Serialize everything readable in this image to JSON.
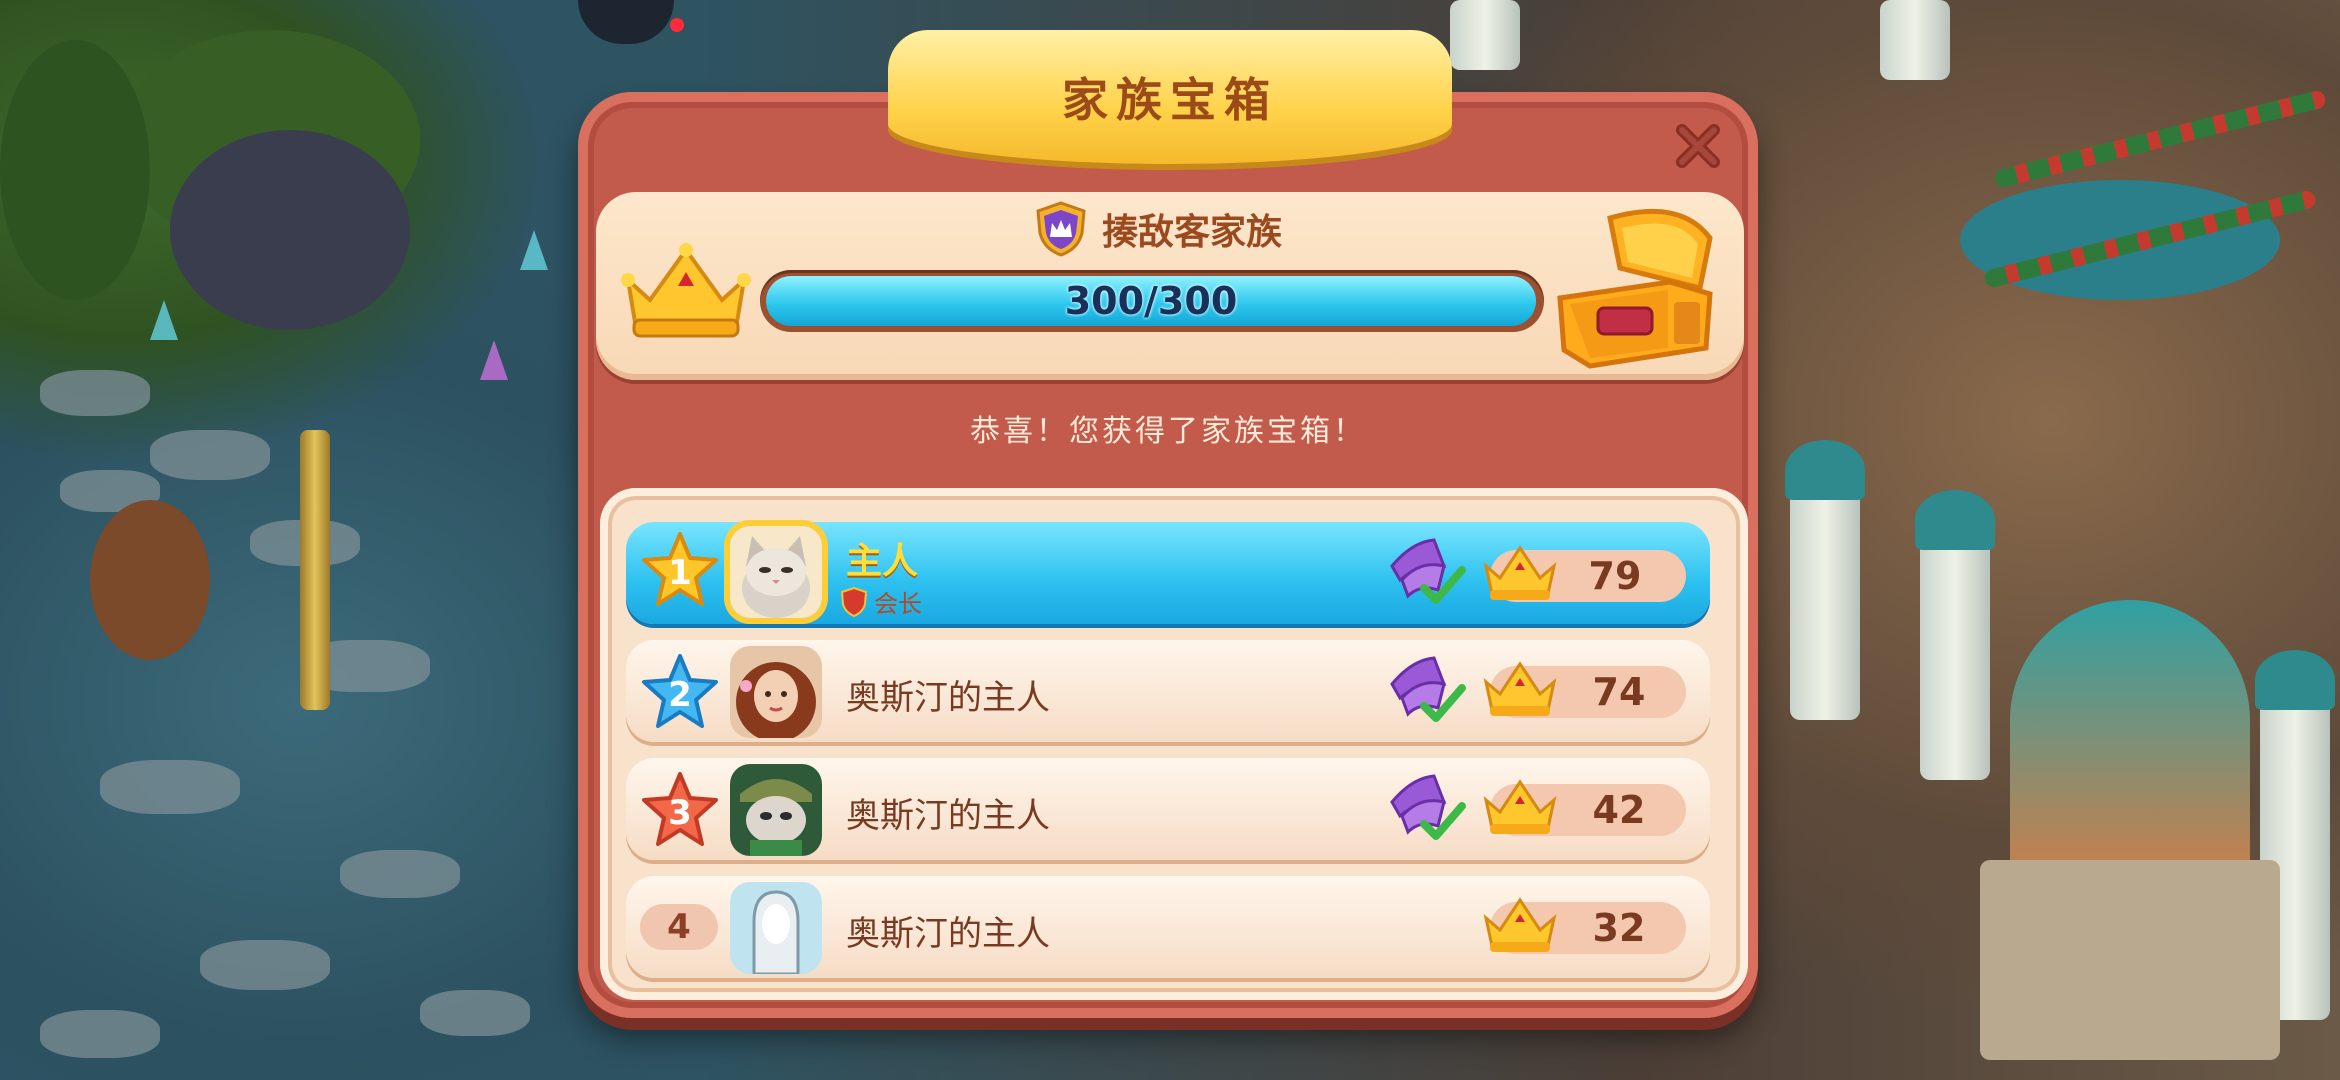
{
  "dialog": {
    "title": "家族宝箱",
    "family_name": "揍敌客家族",
    "progress": {
      "current": 300,
      "max": 300,
      "text": "300/300"
    },
    "congrats": "恭喜！您获得了家族宝箱！"
  },
  "ranking": [
    {
      "rank": "1",
      "name": "主人",
      "role": "会长",
      "score": "79",
      "has_badge": true,
      "highlight": true,
      "star_color": "#ffc62a"
    },
    {
      "rank": "2",
      "name": "奥斯汀的主人",
      "score": "74",
      "has_badge": true,
      "highlight": false,
      "star_color": "#44b8f2"
    },
    {
      "rank": "3",
      "name": "奥斯汀的主人",
      "score": "42",
      "has_badge": true,
      "highlight": false,
      "star_color": "#f26848"
    },
    {
      "rank": "4",
      "name": "奥斯汀的主人",
      "score": "32",
      "has_badge": false,
      "highlight": false
    }
  ],
  "icons": {
    "close": "close-icon",
    "crown": "crown-icon",
    "chest": "treasure-chest-icon",
    "shield": "family-shield-icon",
    "badge": "task-complete-badge-icon"
  },
  "colors": {
    "dialog_bg": "#c25b4c",
    "title_tab": "#ffd24a",
    "progress_fill": "#2fc8ec",
    "highlight_row": "#2cc0ef"
  }
}
